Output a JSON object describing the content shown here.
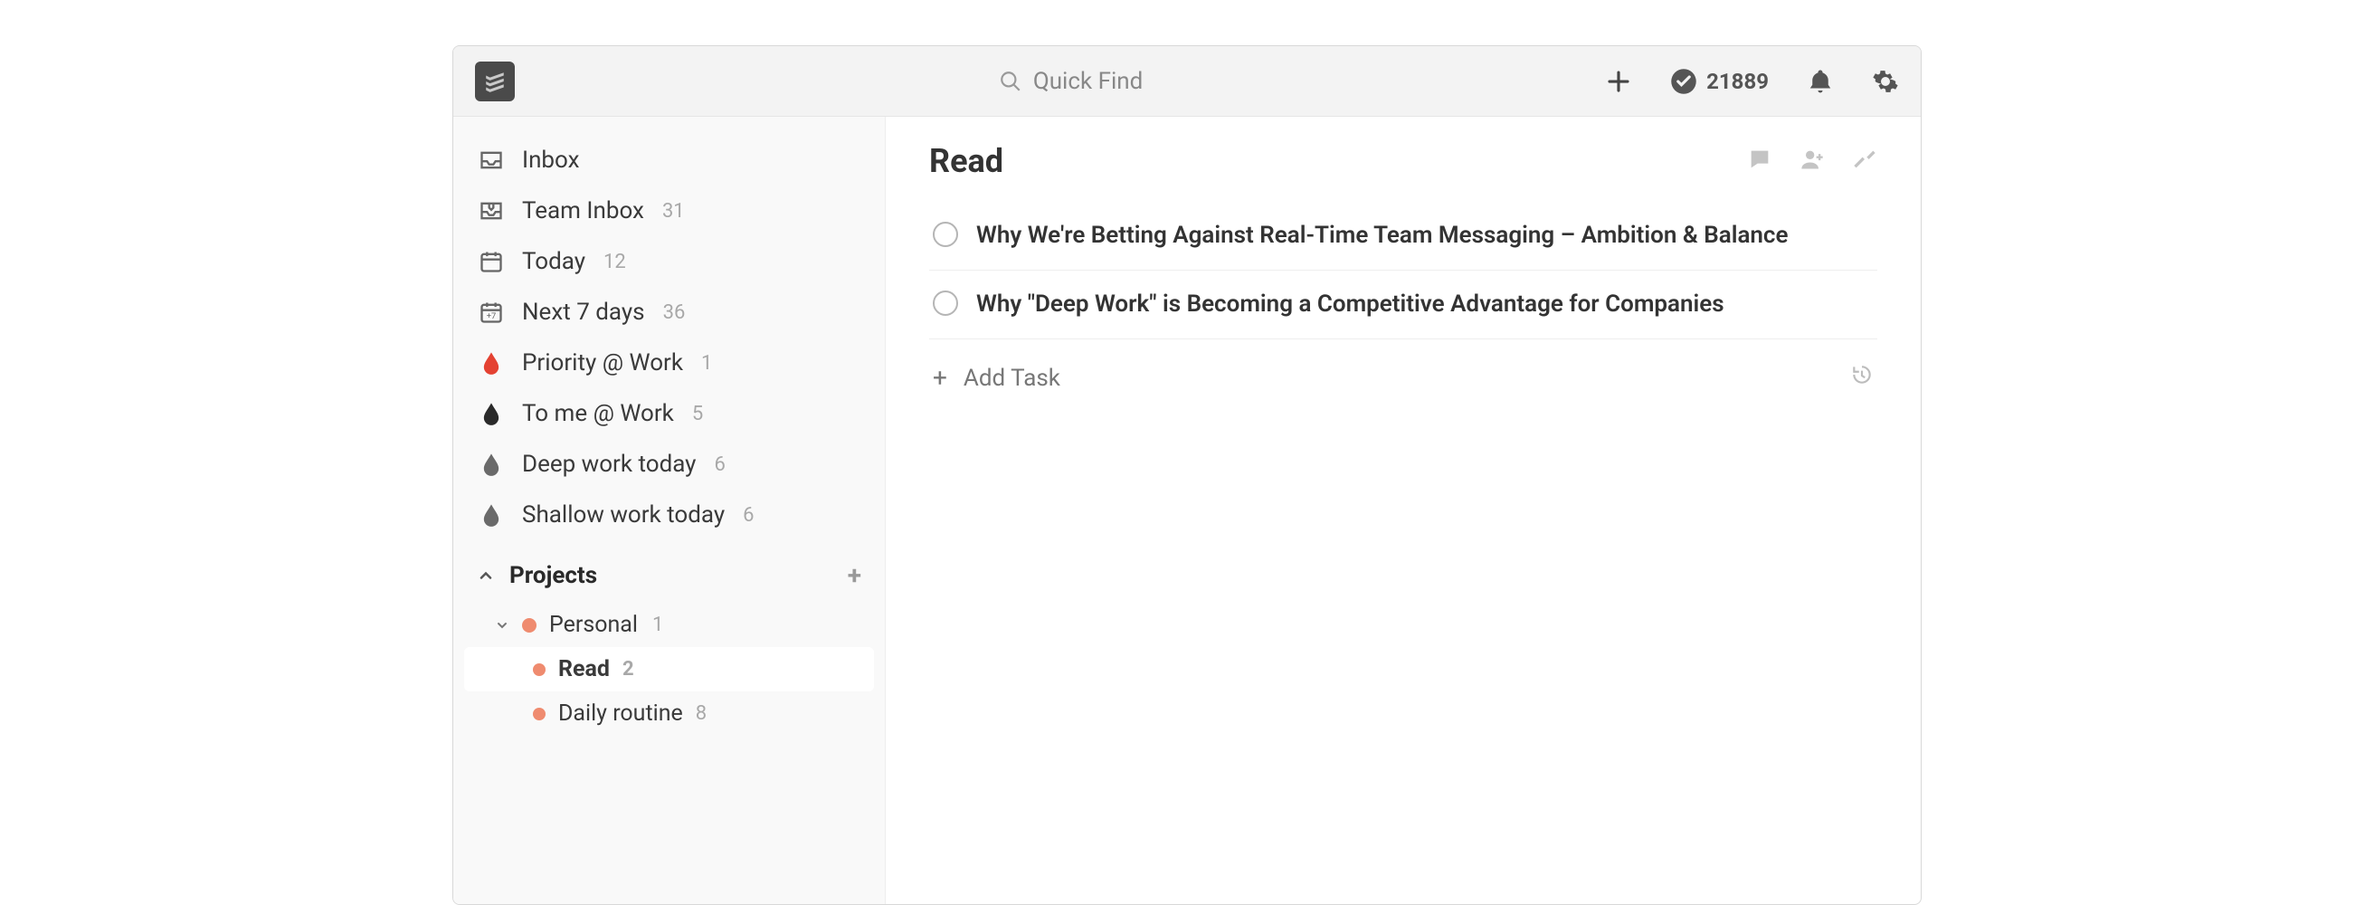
{
  "topbar": {
    "search_placeholder": "Quick Find",
    "karma_count": "21889"
  },
  "sidebar": {
    "nav": [
      {
        "label": "Inbox",
        "count": ""
      },
      {
        "label": "Team Inbox",
        "count": "31"
      },
      {
        "label": "Today",
        "count": "12"
      },
      {
        "label": "Next 7 days",
        "count": "36"
      }
    ],
    "filters": [
      {
        "label": "Priority @ Work",
        "count": "1",
        "color": "red"
      },
      {
        "label": "To me @ Work",
        "count": "5",
        "color": "dark"
      },
      {
        "label": "Deep work today",
        "count": "6",
        "color": "grey"
      },
      {
        "label": "Shallow work today",
        "count": "6",
        "color": "grey"
      }
    ],
    "projects_header": "Projects",
    "project": {
      "label": "Personal",
      "count": "1"
    },
    "subprojects": [
      {
        "label": "Read",
        "count": "2",
        "active": true
      },
      {
        "label": "Daily routine",
        "count": "8",
        "active": false
      }
    ]
  },
  "main": {
    "title": "Read",
    "tasks": [
      {
        "title": "Why We're Betting Against Real-Time Team Messaging – Ambition & Balance"
      },
      {
        "title": "Why \"Deep Work\" is Becoming a Competitive Advantage for Companies"
      }
    ],
    "add_task_label": "Add Task"
  }
}
